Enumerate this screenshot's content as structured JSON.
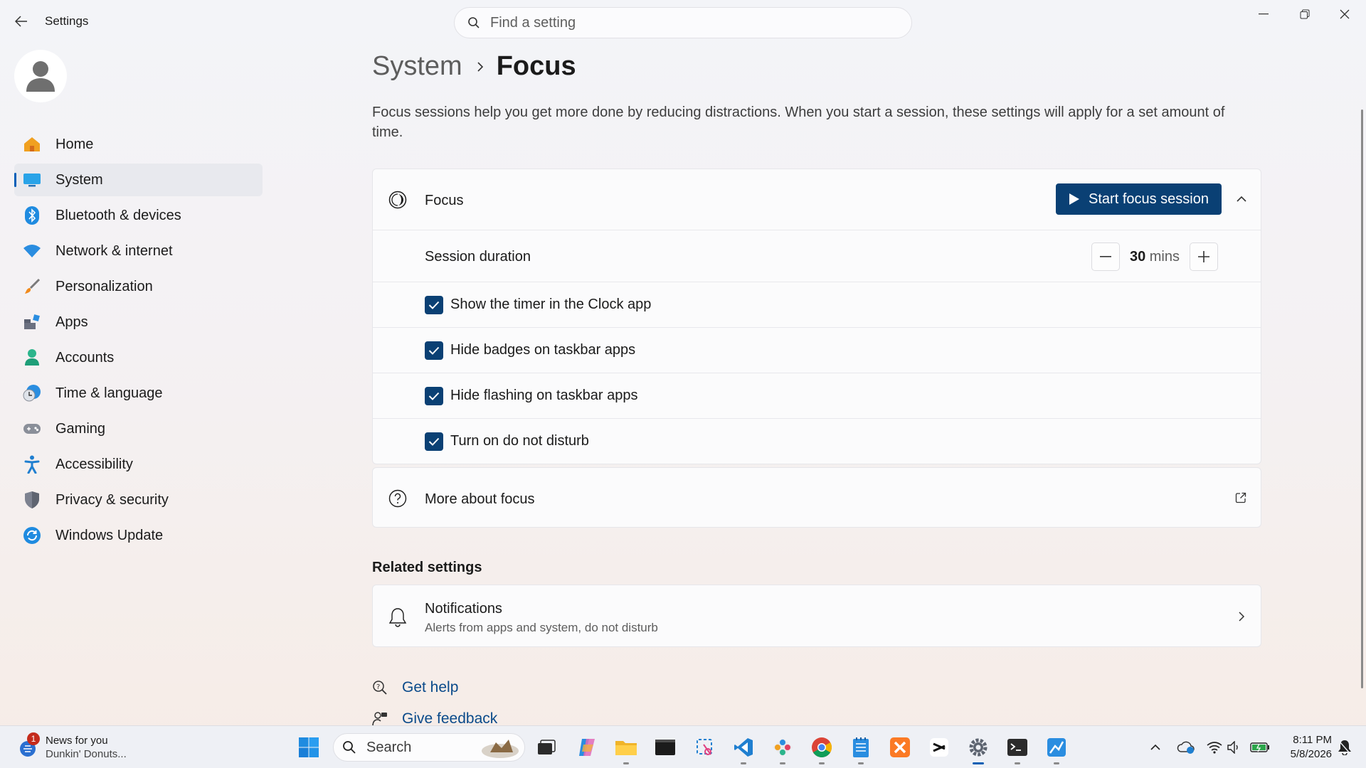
{
  "window": {
    "title": "Settings"
  },
  "search": {
    "placeholder": "Find a setting"
  },
  "sidebar": {
    "items": [
      {
        "label": "Home",
        "icon": "home-icon"
      },
      {
        "label": "System",
        "icon": "monitor-icon",
        "selected": true
      },
      {
        "label": "Bluetooth & devices",
        "icon": "bluetooth-icon"
      },
      {
        "label": "Network & internet",
        "icon": "wifi-icon"
      },
      {
        "label": "Personalization",
        "icon": "brush-icon"
      },
      {
        "label": "Apps",
        "icon": "apps-icon"
      },
      {
        "label": "Accounts",
        "icon": "person-icon"
      },
      {
        "label": "Time & language",
        "icon": "clock-globe-icon"
      },
      {
        "label": "Gaming",
        "icon": "gamepad-icon"
      },
      {
        "label": "Accessibility",
        "icon": "accessibility-icon"
      },
      {
        "label": "Privacy & security",
        "icon": "shield-icon"
      },
      {
        "label": "Windows Update",
        "icon": "update-icon"
      }
    ]
  },
  "breadcrumb": {
    "parent": "System",
    "current": "Focus"
  },
  "description": "Focus sessions help you get more done by reducing distractions. When you start a session, these settings will apply for a set amount of time.",
  "focus_card": {
    "title": "Focus",
    "start_button": "Start focus session",
    "session_duration_label": "Session duration",
    "duration_value": "30",
    "duration_unit": "mins",
    "options": [
      {
        "label": "Show the timer in the Clock app",
        "checked": true
      },
      {
        "label": "Hide badges on taskbar apps",
        "checked": true
      },
      {
        "label": "Hide flashing on taskbar apps",
        "checked": true
      },
      {
        "label": "Turn on do not disturb",
        "checked": true
      }
    ]
  },
  "more_about": {
    "label": "More about focus"
  },
  "related": {
    "title": "Related settings",
    "notifications": {
      "title": "Notifications",
      "subtitle": "Alerts from apps and system, do not disturb"
    }
  },
  "links": {
    "help": "Get help",
    "feedback": "Give feedback"
  },
  "taskbar": {
    "news": {
      "title": "News for you",
      "subtitle": "Dunkin' Donuts...",
      "badge": "1"
    },
    "search_label": "Search",
    "time": "8:11 PM",
    "date": "5/8/2026"
  },
  "colors": {
    "accent": "#0a4074",
    "link": "#0a4a8a",
    "selected_bg": "#e8e9ee"
  }
}
